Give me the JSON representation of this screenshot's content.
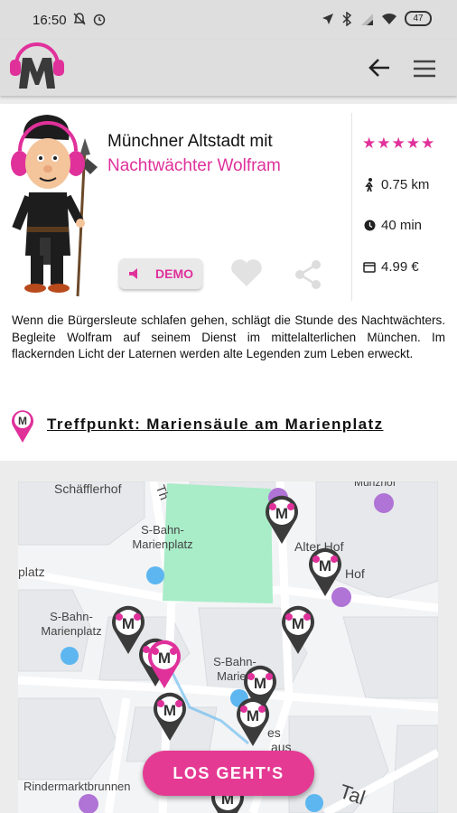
{
  "status": {
    "time": "16:50",
    "battery": "47"
  },
  "app_bar": {
    "logo_alt": "M"
  },
  "tour": {
    "title_line1": "Münchner Altstadt mit",
    "title_line2": "Nachtwächter Wolfram",
    "rating_stars": 5,
    "distance": "0.75 km",
    "duration": "40 min",
    "price": "4.99 €",
    "demo_label": "DEMO",
    "description": "Wenn die Bürgersleute schlafen gehen, schlägt die Stunde des Nachtwächters. Begleite Wolfram auf seinem Dienst im mittelalterlichen München. Im flackernden Licht der Laternen werden alte Legenden zum Leben erweckt.",
    "meeting_point": "Treffpunkt: Mariensäule am Marienplatz"
  },
  "map": {
    "labels": {
      "schaefflerhof": "Schäfflerhof",
      "theatiner": "Th",
      "sbahn_top": "S-Bahn-\nMarienplatz",
      "platz": "platz",
      "alter_hof": "Alter Hof",
      "hof": "Hof",
      "munzhof": "Münzhof",
      "sbahn_left": "S-Bahn-\nMarienplatz",
      "sbahn_center": "S-Bahn-\nMarien",
      "es": "es",
      "aus": "aus",
      "rindermarkt": "Rindermarktbrunnen",
      "tal": "Tal"
    }
  },
  "cta_label": "LOS GEHT'S",
  "colors": {
    "accent": "#e0319b",
    "park": "#a8ecc8"
  }
}
